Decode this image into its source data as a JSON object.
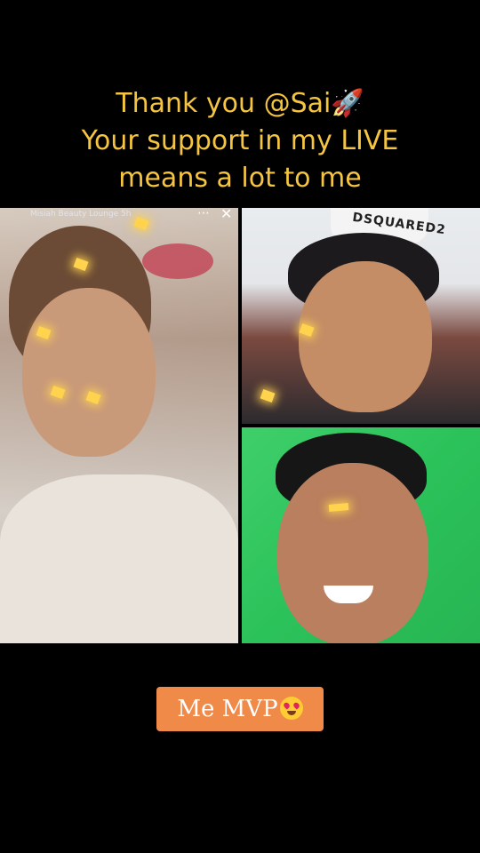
{
  "caption": {
    "line1": "Thank you @Sai🚀",
    "line2": "Your support in my LIVE",
    "line3": "means a lot to me"
  },
  "live_tiles": {
    "host_stream_title": "Misiah Beauty Lounge 5h",
    "more_icon": "⋯",
    "close_icon": "✕",
    "shirt_brand": "DSQUARED2"
  },
  "badge": {
    "label": "Me MVP"
  },
  "colors": {
    "caption": "#f5c542",
    "badge_bg": "#f08a49",
    "green_screen": "#2cc25a"
  }
}
